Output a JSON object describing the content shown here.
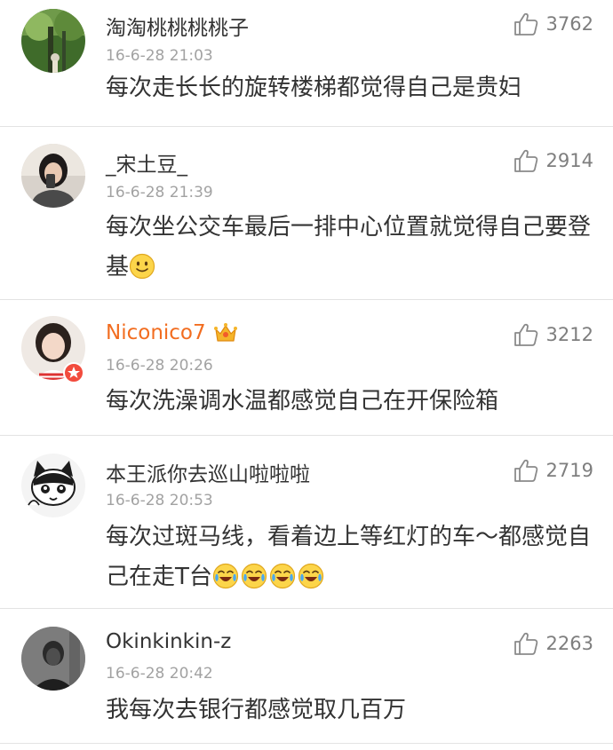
{
  "comments": [
    {
      "user": "淘淘桃桃桃桃子",
      "time": "16-6-28 21:03",
      "likes": "3762",
      "text": "每次走长长的旋转楼梯都觉得自己是贵妇",
      "emoji": "",
      "avatar": "forest-photo"
    },
    {
      "user": "_宋土豆_",
      "time": "16-6-28 21:39",
      "likes": "2914",
      "text": "每次坐公交车最后一排中心位置就觉得自己要登基",
      "emoji": "smile",
      "avatar": "selfie-girl"
    },
    {
      "user": "Niconico7",
      "time": "16-6-28 20:26",
      "likes": "3212",
      "text": "每次洗澡调水温都感觉自己在开保险箱",
      "emoji": "",
      "avatar": "girl-portrait",
      "vip_crown": true,
      "verified_badge": true
    },
    {
      "user": "本王派你去巡山啦啦啦",
      "time": "16-6-28 20:53",
      "likes": "2719",
      "text": "每次过斑马线，看着边上等红灯的车～都感觉自己在走T台",
      "emoji": "laugh-cry x4",
      "avatar": "cartoon-cat"
    },
    {
      "user": "Okinkinkin-z",
      "time": "16-6-28 20:42",
      "likes": "2263",
      "text": "我每次去银行都感觉取几百万",
      "emoji": "",
      "avatar": "dark-portrait"
    }
  ],
  "colors": {
    "vip_name": "#f26d20",
    "time": "#a2a2a2",
    "divider": "#e3e3e3",
    "like_text": "#7e7e7e"
  },
  "icons": {
    "like": "thumbs-up-icon",
    "crown": "crown-icon",
    "badge": "verified-badge-icon",
    "emoji_smile": "smile-emoji-icon",
    "emoji_laugh": "laugh-cry-emoji-icon"
  }
}
